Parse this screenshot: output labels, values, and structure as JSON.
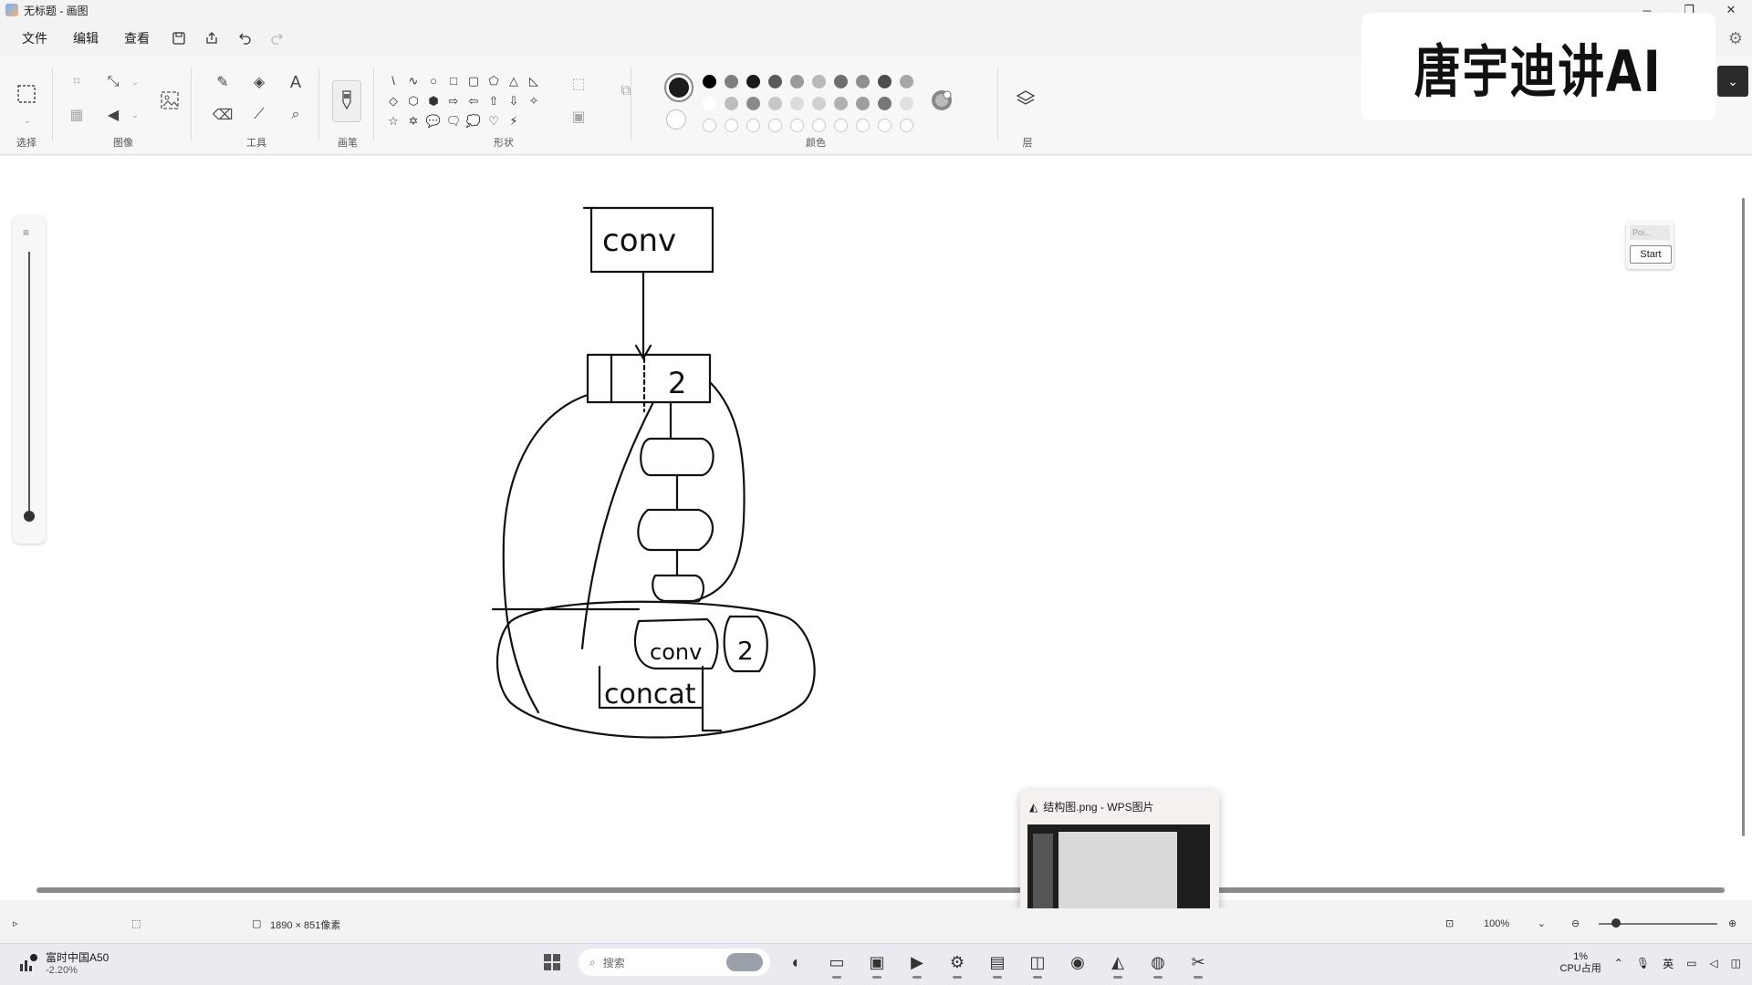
{
  "window": {
    "title": "无标题 - 画图",
    "controls": [
      "─",
      "❐",
      "✕"
    ]
  },
  "menu": {
    "file": "文件",
    "edit": "编辑",
    "view": "查看",
    "save_icon": "save-icon",
    "share_icon": "share-icon",
    "undo_icon": "undo-icon",
    "redo_icon": "redo-icon"
  },
  "ribbon": {
    "groups": {
      "select": "选择",
      "image": "图像",
      "tools": "工具",
      "brushes": "画笔",
      "shapes": "形状",
      "colors": "颜色",
      "layers": "层"
    },
    "shapes": [
      "\\",
      "∿",
      "○",
      "□",
      "▢",
      "⬠",
      "△",
      "◺",
      "◇",
      "⬡",
      "⬢",
      "⇨",
      "⇦",
      "⇧",
      "⇩",
      "✧",
      "☆",
      "✡",
      "💬",
      "🗨",
      "💭",
      "♡",
      "⚡",
      ""
    ],
    "primary_color": "#1b1b1b",
    "palette_row1": [
      "#000000",
      "#7f7f7f",
      "#1b1b1b",
      "#5a5a5a",
      "#9a9a9a",
      "#b9b9b9",
      "#6e6e6e",
      "#8e8e8e",
      "#4d4d4d",
      "#a6a6a6"
    ],
    "palette_row2": [
      "#ffffff",
      "#bdbdbd",
      "#8a8a8a",
      "#c7c7c7",
      "#dcdcdc",
      "#d0d0d0",
      "#b0b0b0",
      "#9e9e9e",
      "#777777",
      "#e0e0e0"
    ]
  },
  "brand": {
    "text": "唐宇迪讲AI"
  },
  "canvas": {
    "labels": [
      "conv",
      "2",
      "conv",
      "2",
      "concat"
    ]
  },
  "mini_widget": {
    "top": "Poi...",
    "button": "Start"
  },
  "thumbnail": {
    "title": "结构图.png - WPS图片"
  },
  "statusbar": {
    "canvas_size": "1890 × 851像素",
    "zoom": "100%"
  },
  "taskbar": {
    "stock_name": "富时中国A50",
    "stock_change": "-2.20%",
    "search_placeholder": "搜索",
    "cpu_value": "1%",
    "cpu_label": "CPU占用",
    "ime_lang": "英"
  }
}
